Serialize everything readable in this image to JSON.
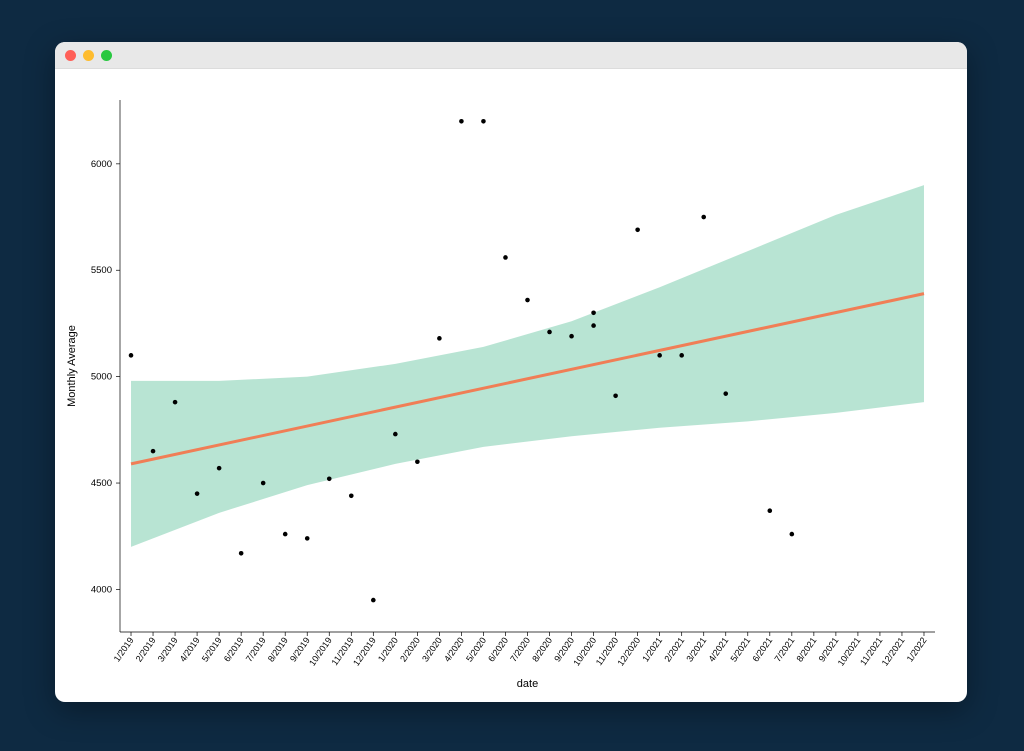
{
  "window": {
    "traffic_lights": [
      "close",
      "minimize",
      "zoom"
    ]
  },
  "chart_data": {
    "type": "scatter",
    "title": "",
    "xlabel": "date",
    "ylabel": "Monthly Average",
    "ylim": [
      3800,
      6300
    ],
    "y_ticks": [
      4000,
      4500,
      5000,
      5500,
      6000
    ],
    "categories": [
      "1/2019",
      "2/2019",
      "3/2019",
      "4/2019",
      "5/2019",
      "6/2019",
      "7/2019",
      "8/2019",
      "9/2019",
      "10/2019",
      "11/2019",
      "12/2019",
      "1/2020",
      "2/2020",
      "3/2020",
      "4/2020",
      "5/2020",
      "6/2020",
      "7/2020",
      "8/2020",
      "9/2020",
      "10/2020",
      "11/2020",
      "12/2020",
      "1/2021",
      "2/2021",
      "3/2021",
      "4/2021",
      "5/2021",
      "6/2021",
      "7/2021",
      "8/2021",
      "9/2021",
      "10/2021",
      "11/2021",
      "12/2021",
      "1/2022"
    ],
    "points": [
      {
        "x": "1/2019",
        "y": 5100
      },
      {
        "x": "2/2019",
        "y": 4650
      },
      {
        "x": "3/2019",
        "y": 4880
      },
      {
        "x": "4/2019",
        "y": 4450
      },
      {
        "x": "5/2019",
        "y": 4570
      },
      {
        "x": "6/2019",
        "y": 4170
      },
      {
        "x": "7/2019",
        "y": 4500
      },
      {
        "x": "8/2019",
        "y": 4260
      },
      {
        "x": "9/2019",
        "y": 4240
      },
      {
        "x": "10/2019",
        "y": 4520
      },
      {
        "x": "11/2019",
        "y": 4440
      },
      {
        "x": "12/2019",
        "y": 3950
      },
      {
        "x": "1/2020",
        "y": 4730
      },
      {
        "x": "2/2020",
        "y": 4600
      },
      {
        "x": "3/2020",
        "y": 5180
      },
      {
        "x": "4/2020",
        "y": 6200
      },
      {
        "x": "5/2020",
        "y": 6200
      },
      {
        "x": "6/2020",
        "y": 5560
      },
      {
        "x": "7/2020",
        "y": 5360
      },
      {
        "x": "8/2020",
        "y": 5210
      },
      {
        "x": "9/2020",
        "y": 5190
      },
      {
        "x": "10/2020",
        "y": 5240
      },
      {
        "x": "10/2020",
        "y": 5300
      },
      {
        "x": "11/2020",
        "y": 4910
      },
      {
        "x": "12/2020",
        "y": 5690
      },
      {
        "x": "1/2021",
        "y": 5100
      },
      {
        "x": "2/2021",
        "y": 5100
      },
      {
        "x": "3/2021",
        "y": 5750
      },
      {
        "x": "4/2021",
        "y": 4920
      },
      {
        "x": "6/2021",
        "y": 4370
      },
      {
        "x": "7/2021",
        "y": 4260
      }
    ],
    "trend": {
      "x1": "1/2019",
      "y1": 4590,
      "x2": "1/2022",
      "y2": 5390
    },
    "ci_band": {
      "lower": [
        {
          "x": "1/2019",
          "y": 4200
        },
        {
          "x": "5/2019",
          "y": 4360
        },
        {
          "x": "9/2019",
          "y": 4490
        },
        {
          "x": "1/2020",
          "y": 4590
        },
        {
          "x": "5/2020",
          "y": 4670
        },
        {
          "x": "9/2020",
          "y": 4720
        },
        {
          "x": "1/2021",
          "y": 4760
        },
        {
          "x": "5/2021",
          "y": 4790
        },
        {
          "x": "9/2021",
          "y": 4830
        },
        {
          "x": "1/2022",
          "y": 4880
        }
      ],
      "upper": [
        {
          "x": "1/2019",
          "y": 4980
        },
        {
          "x": "5/2019",
          "y": 4980
        },
        {
          "x": "9/2019",
          "y": 5000
        },
        {
          "x": "1/2020",
          "y": 5060
        },
        {
          "x": "5/2020",
          "y": 5140
        },
        {
          "x": "9/2020",
          "y": 5260
        },
        {
          "x": "1/2021",
          "y": 5420
        },
        {
          "x": "5/2021",
          "y": 5590
        },
        {
          "x": "9/2021",
          "y": 5760
        },
        {
          "x": "1/2022",
          "y": 5900
        }
      ]
    }
  }
}
